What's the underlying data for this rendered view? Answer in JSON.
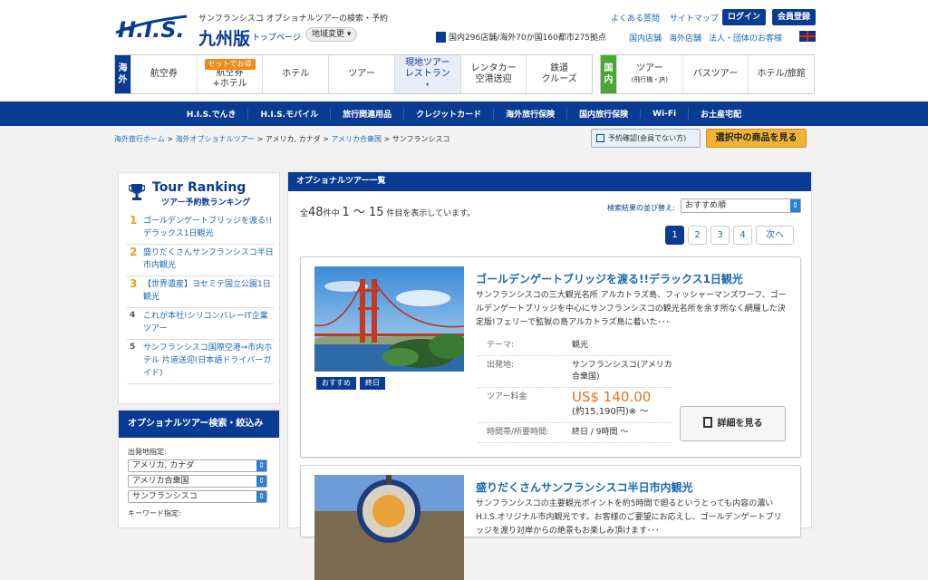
{
  "header": {
    "logo_text": "H.I.S.",
    "tagline": "サンフランシスコ オプショナルツアーの検索・予約",
    "region": "九州版",
    "toppage": "トップページ",
    "region_change": "地域変更",
    "faq": "よくある質問",
    "sitemap": "サイトマップ",
    "login": "ログイン",
    "register": "会員登録",
    "stores": "国内296店舗/海外70か国160都市275拠点",
    "store_links": [
      "国内店舗",
      "海外店舗",
      "法人・団体のお客様"
    ]
  },
  "nav_overseas": {
    "tag": "海外",
    "items": [
      {
        "label": "航空券",
        "sub": "",
        "badge": ""
      },
      {
        "label": "航空券\n+ホテル",
        "sub": "",
        "badge": "セットでお得"
      },
      {
        "label": "ホテル",
        "sub": "",
        "badge": ""
      },
      {
        "label": "ツアー",
        "sub": "",
        "badge": ""
      },
      {
        "label": "現地ツアー\nレストラン",
        "sub": "",
        "badge": ""
      },
      {
        "label": "レンタカー\n空港送迎",
        "sub": "",
        "badge": ""
      },
      {
        "label": "鉄道\nクルーズ",
        "sub": "",
        "badge": ""
      }
    ]
  },
  "nav_domestic": {
    "tag": "国内",
    "items": [
      {
        "label": "ツアー",
        "sub": "(飛行機・JR)"
      },
      {
        "label": "バスツアー",
        "sub": ""
      },
      {
        "label": "ホテル/旅館",
        "sub": ""
      }
    ]
  },
  "bluebar": [
    "H.I.S.でんき",
    "H.I.S.モバイル",
    "旅行関連用品",
    "クレジットカード",
    "海外旅行保険",
    "国内旅行保険",
    "Wi-Fi",
    "お土産宅配"
  ],
  "breadcrumb": {
    "items": [
      "海外旅行ホーム",
      "海外オプショナルツアー",
      "アメリカ, カナダ",
      "アメリカ合衆国",
      "サンフランシスコ"
    ],
    "sep": " > "
  },
  "buttons": {
    "confirm": "予約確認(会員でない方)",
    "view_selected": "選択中の商品を見る"
  },
  "ranking": {
    "title_en": "Tour Ranking",
    "title_ja": "ツアー予約数ランキング",
    "items": [
      {
        "num": "1",
        "text": "ゴールデンゲートブリッジを渡る!!デラックス1日観光"
      },
      {
        "num": "2",
        "text": "盛りだくさんサンフランシスコ半日市内観光"
      },
      {
        "num": "3",
        "text": "【世界遺産】ヨセミテ国立公園1日観光"
      },
      {
        "num": "4",
        "text": "これが本社!シリコンバレーIT企業ツアー"
      },
      {
        "num": "5",
        "text": "サンフランシスコ国際空港⇒市内ホテル 片道送迎(日本語ドライバーガイド)"
      }
    ]
  },
  "search": {
    "title": "オプショナルツアー検索・絞込み",
    "dep_label": "出発地指定:",
    "selects": [
      "アメリカ, カナダ",
      "アメリカ合衆国",
      "サンフランシスコ"
    ],
    "keyword_label": "キーワード指定:"
  },
  "list": {
    "title": "オプショナルツアー一覧",
    "count_prefix": "全",
    "count_total": "48",
    "count_mid": "件中",
    "count_range": "1 〜 15",
    "count_suffix": "件目を表示しています。",
    "sort_label": "検索結果の並び替え:",
    "sort_value": "おすすめ順",
    "pages": [
      "1",
      "2",
      "3",
      "4",
      "次へ"
    ]
  },
  "cards": [
    {
      "title": "ゴールデンゲートブリッジを渡る!!デラックス1日観光",
      "desc": "サンフランシスコの三大観光名所 アルカトラズ島、フィッシャーマンズワーフ、ゴールデンゲートブリッジを中心にサンフランシスコの観光名所を余す所なく網羅した決定版!フェリーで監獄の島アルカトラズ島に着いた･･･",
      "tags": [
        "おすすめ",
        "終日"
      ],
      "theme_k": "テーマ:",
      "theme_v": "観光",
      "dep_k": "出発地:",
      "dep_v": "サンフランシスコ(アメリカ合衆国)",
      "price_k": "ツアー料金",
      "price": "US$ 140.00",
      "price_yen": "(約15,190円)※ 〜",
      "time_k": "時間帯/所要時間:",
      "time_v": "終日 / 9時間 〜",
      "detail": "詳細を見る"
    },
    {
      "title": "盛りだくさんサンフランシスコ半日市内観光",
      "desc": "サンフランシスコの主要観光ポイントを約5時間で廻るというとっても内容の濃いH.I.S.オリジナル市内観光です。お客様のご要望にお応えし、ゴールデンゲートブリッジを渡り対岸からの絶景もお楽しみ頂けます･･･"
    }
  ]
}
